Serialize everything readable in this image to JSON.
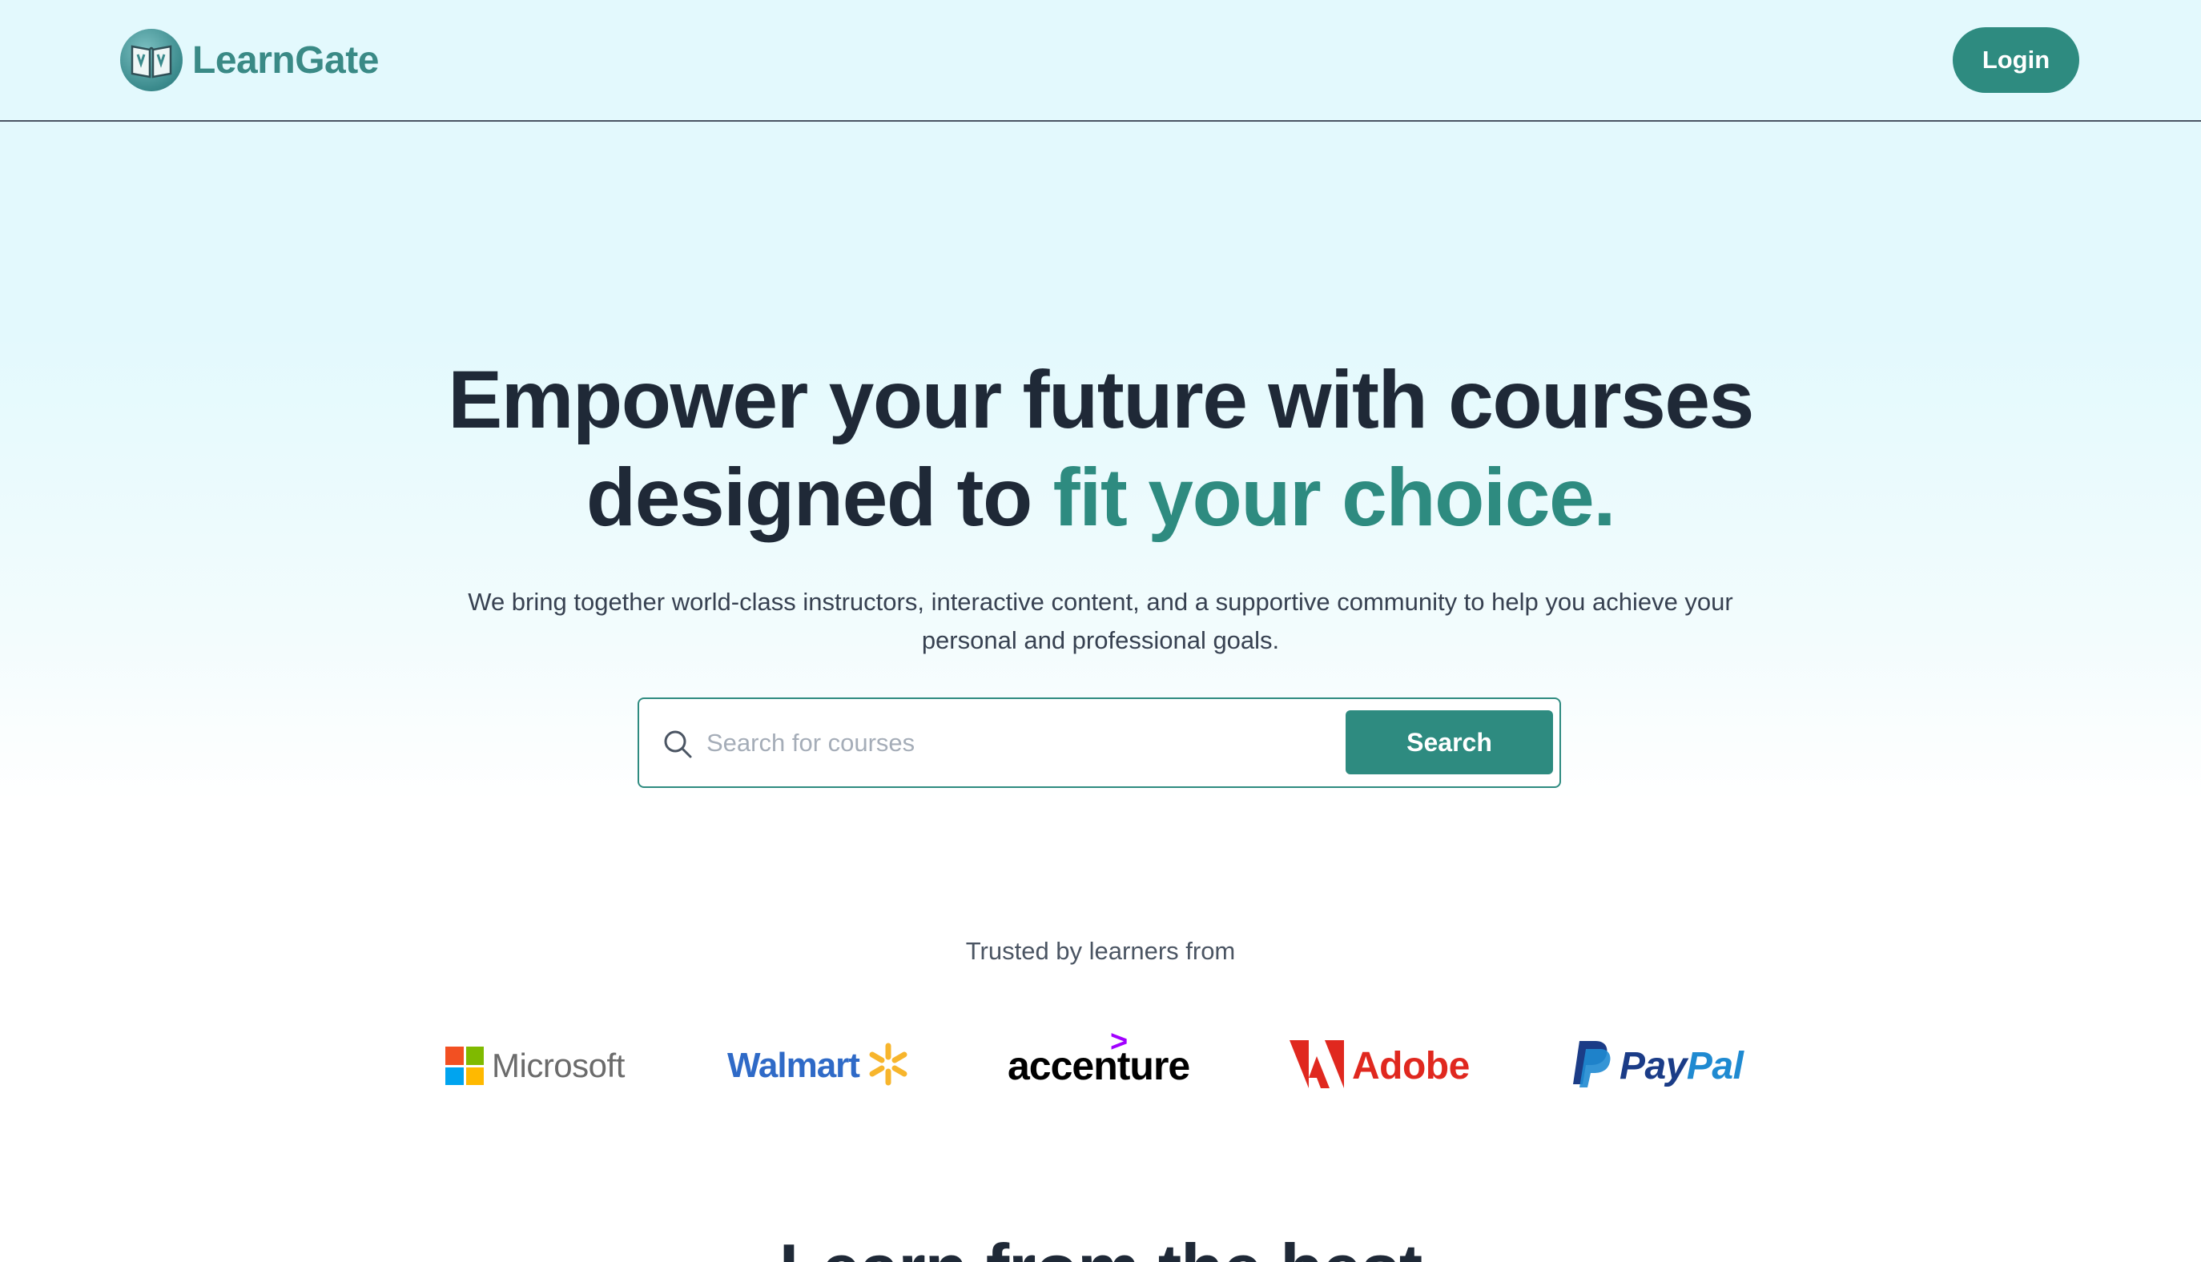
{
  "header": {
    "logo_text": "LearnGate",
    "login_label": "Login"
  },
  "hero": {
    "title_line1": "Empower your future with courses",
    "title_line2_plain": "designed to ",
    "title_line2_accent": "fit your choice.",
    "subtitle": "We bring together world-class instructors, interactive content, and a supportive community to help you achieve your personal and professional goals."
  },
  "search": {
    "placeholder": "Search for courses",
    "value": "",
    "button_label": "Search"
  },
  "trusted": {
    "label": "Trusted by learners from",
    "brands": {
      "microsoft": "Microsoft",
      "walmart": "Walmart",
      "accenture": "accenture",
      "adobe": "Adobe",
      "paypal_pay": "Pay",
      "paypal_pal": "Pal"
    }
  },
  "next_section": {
    "heading": "Learn from the best"
  },
  "colors": {
    "accent": "#2e8b80",
    "header_bg": "#e3f9fd",
    "heading": "#1f2937"
  }
}
